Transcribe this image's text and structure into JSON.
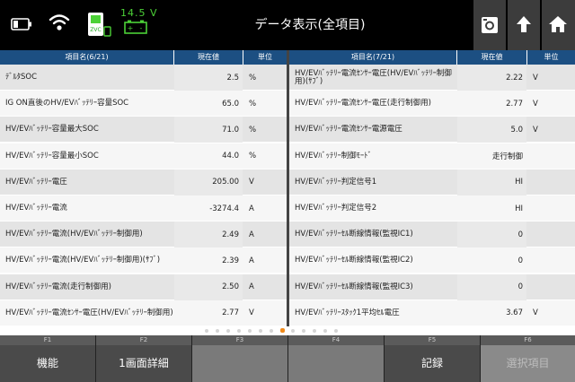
{
  "header": {
    "title": "データ表示(全項目)",
    "voltage": "14.5 V"
  },
  "icons": {
    "battery": "battery-icon",
    "wifi": "wifi-icon",
    "vci": "vci-device-icon",
    "car_battery": "car-battery-icon",
    "camera": "camera-icon",
    "up": "upload-icon",
    "home": "home-icon"
  },
  "left_table": {
    "header_name": "項目名(6/21)",
    "header_value": "現在値",
    "header_unit": "単位",
    "rows": [
      {
        "name": "ﾃﾞﾙﾀSOC",
        "value": "2.5",
        "unit": "%"
      },
      {
        "name": "IG ON直後のHV/EVﾊﾞｯﾃﾘｰ容量SOC",
        "value": "65.0",
        "unit": "%"
      },
      {
        "name": "HV/EVﾊﾞｯﾃﾘｰ容量最大SOC",
        "value": "71.0",
        "unit": "%"
      },
      {
        "name": "HV/EVﾊﾞｯﾃﾘｰ容量最小SOC",
        "value": "44.0",
        "unit": "%"
      },
      {
        "name": "HV/EVﾊﾞｯﾃﾘｰ電圧",
        "value": "205.00",
        "unit": "V"
      },
      {
        "name": "HV/EVﾊﾞｯﾃﾘｰ電流",
        "value": "-3274.4",
        "unit": "A"
      },
      {
        "name": "HV/EVﾊﾞｯﾃﾘｰ電流(HV/EVﾊﾞｯﾃﾘｰ制御用)",
        "value": "2.49",
        "unit": "A"
      },
      {
        "name": "HV/EVﾊﾞｯﾃﾘｰ電流(HV/EVﾊﾞｯﾃﾘｰ制御用)(ｻﾌﾞ)",
        "value": "2.39",
        "unit": "A"
      },
      {
        "name": "HV/EVﾊﾞｯﾃﾘｰ電流(走行制御用)",
        "value": "2.50",
        "unit": "A"
      },
      {
        "name": "HV/EVﾊﾞｯﾃﾘｰ電流ｾﾝｻｰ電圧(HV/EVﾊﾞｯﾃﾘｰ制御用)",
        "value": "2.77",
        "unit": "V"
      }
    ]
  },
  "right_table": {
    "header_name": "項目名(7/21)",
    "header_value": "現在値",
    "header_unit": "単位",
    "rows": [
      {
        "name": "HV/EVﾊﾞｯﾃﾘｰ電流ｾﾝｻｰ電圧(HV/EVﾊﾞｯﾃﾘｰ制御用)(ｻﾌﾞ)",
        "value": "2.22",
        "unit": "V"
      },
      {
        "name": "HV/EVﾊﾞｯﾃﾘｰ電流ｾﾝｻｰ電圧(走行制御用)",
        "value": "2.77",
        "unit": "V"
      },
      {
        "name": "HV/EVﾊﾞｯﾃﾘｰ電流ｾﾝｻｰ電源電圧",
        "value": "5.0",
        "unit": "V"
      },
      {
        "name": "HV/EVﾊﾞｯﾃﾘｰ制御ﾓｰﾄﾞ",
        "value": "走行制御",
        "unit": ""
      },
      {
        "name": "HV/EVﾊﾞｯﾃﾘｰ判定信号1",
        "value": "HI",
        "unit": ""
      },
      {
        "name": "HV/EVﾊﾞｯﾃﾘｰ判定信号2",
        "value": "HI",
        "unit": ""
      },
      {
        "name": "HV/EVﾊﾞｯﾃﾘｰｾﾙ断線情報(監視IC1)",
        "value": "0",
        "unit": ""
      },
      {
        "name": "HV/EVﾊﾞｯﾃﾘｰｾﾙ断線情報(監視IC2)",
        "value": "0",
        "unit": ""
      },
      {
        "name": "HV/EVﾊﾞｯﾃﾘｰｾﾙ断線情報(監視IC3)",
        "value": "0",
        "unit": ""
      },
      {
        "name": "HV/EVﾊﾞｯﾃﾘｰｽﾀｯｸ1平均ｾﾙ電圧",
        "value": "3.67",
        "unit": "V"
      }
    ]
  },
  "pager": {
    "total": 13,
    "active": 7
  },
  "function_keys": [
    {
      "key": "F1",
      "label": "機能"
    },
    {
      "key": "F2",
      "label": "1画面詳細"
    },
    {
      "key": "F3",
      "label": ""
    },
    {
      "key": "F4",
      "label": ""
    },
    {
      "key": "F5",
      "label": "記録"
    },
    {
      "key": "F6",
      "label": "選択項目"
    }
  ]
}
